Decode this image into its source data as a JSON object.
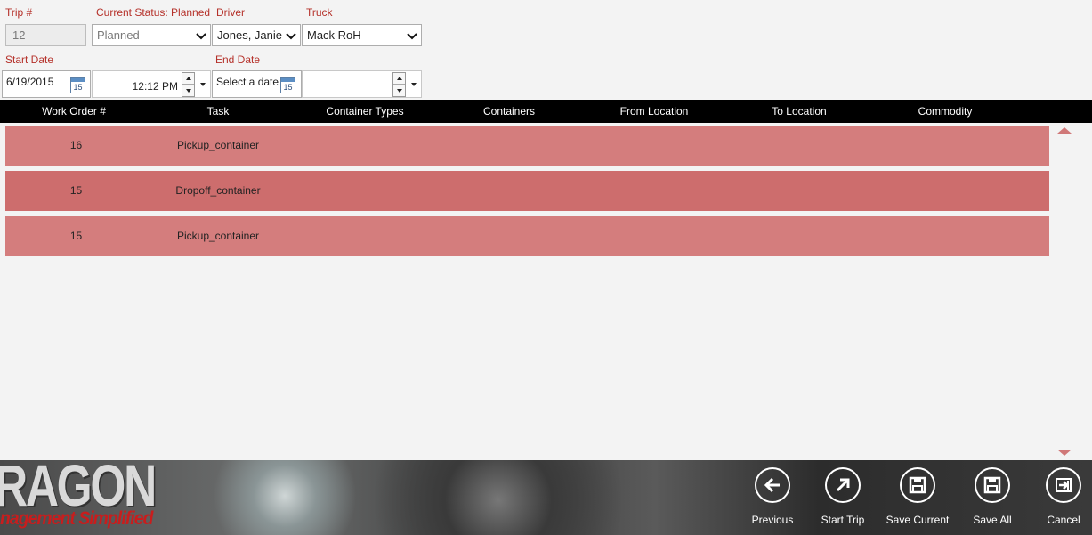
{
  "form": {
    "trip_label": "Trip #",
    "trip_value": "12",
    "status_label": "Current Status: Planned",
    "status_value": "Planned",
    "driver_label": "Driver",
    "driver_value": "Jones, Janie",
    "truck_label": "Truck",
    "truck_value": "Mack RoH",
    "start_date_label": "Start Date",
    "start_date_value": "6/19/2015",
    "start_time_value": "12:12 PM",
    "end_date_label": "End Date",
    "end_date_placeholder": "Select a date",
    "calendar_day": "15"
  },
  "table": {
    "columns": [
      "Work Order #",
      "Task",
      "Container Types",
      "Containers",
      "From Location",
      "To Location",
      "Commodity"
    ],
    "rows": [
      {
        "work_order": "16",
        "task": "Pickup_container",
        "container_types": "",
        "containers": "",
        "from": "",
        "to": "",
        "commodity": ""
      },
      {
        "work_order": "15",
        "task": "Dropoff_container",
        "container_types": "",
        "containers": "",
        "from": "",
        "to": "",
        "commodity": ""
      },
      {
        "work_order": "15",
        "task": "Pickup_container",
        "container_types": "",
        "containers": "",
        "from": "",
        "to": "",
        "commodity": ""
      }
    ],
    "row_colors": [
      "#d47d7d",
      "#cd6d6d",
      "#d47d7d"
    ]
  },
  "branding": {
    "logo_text": "RAGON",
    "tagline": "nagement Simplified"
  },
  "appbar": {
    "previous": "Previous",
    "start_trip": "Start Trip",
    "save_current": "Save Current",
    "save_all": "Save All",
    "cancel": "Cancel"
  },
  "colors": {
    "label_red": "#b5312a",
    "header_bg": "#000000",
    "row_accent": "#d47d7d",
    "scroll_arrow": "#d07878"
  }
}
